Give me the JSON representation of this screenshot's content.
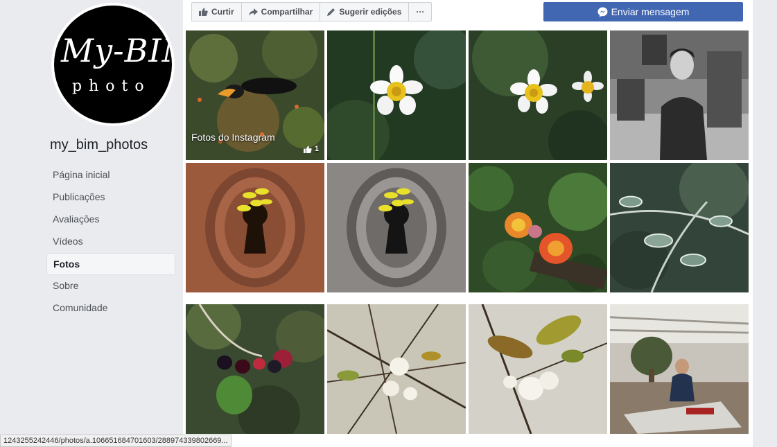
{
  "page": {
    "name": "my_bim_photos",
    "logo": {
      "main": "My-BIM",
      "sub": "photo"
    }
  },
  "nav": [
    {
      "label": "Página inicial",
      "active": false
    },
    {
      "label": "Publicações",
      "active": false
    },
    {
      "label": "Avaliações",
      "active": false
    },
    {
      "label": "Vídeos",
      "active": false
    },
    {
      "label": "Fotos",
      "active": true
    },
    {
      "label": "Sobre",
      "active": false
    },
    {
      "label": "Comunidade",
      "active": false
    }
  ],
  "actions": {
    "like": "Curtir",
    "share": "Compartilhar",
    "suggest": "Sugerir edições",
    "more": "···",
    "message": "Enviar mensagem"
  },
  "album": {
    "label": "Fotos do Instagram",
    "likes": "1"
  },
  "photos": [
    {
      "subject": "toucan in tree",
      "style": "color"
    },
    {
      "subject": "white daisy flower",
      "style": "color"
    },
    {
      "subject": "two white daisy flowers",
      "style": "color"
    },
    {
      "subject": "smiling man portrait",
      "style": "bw"
    },
    {
      "subject": "yellow flower in keyhole",
      "style": "color"
    },
    {
      "subject": "yellow flower in keyhole grey",
      "style": "partial"
    },
    {
      "subject": "lantana flowers",
      "style": "color"
    },
    {
      "subject": "frosted leaves",
      "style": "color"
    },
    {
      "subject": "blackberries",
      "style": "color"
    },
    {
      "subject": "white blossoms on branches",
      "style": "color"
    },
    {
      "subject": "white blossom with leaves",
      "style": "color"
    },
    {
      "subject": "woman in food court",
      "style": "color"
    }
  ],
  "status_bar": {
    "url": "1243255242446/photos/a.106651684701603/288974339802669..."
  },
  "colors": {
    "brand": "#4267b2",
    "background": "#e9ebee"
  }
}
